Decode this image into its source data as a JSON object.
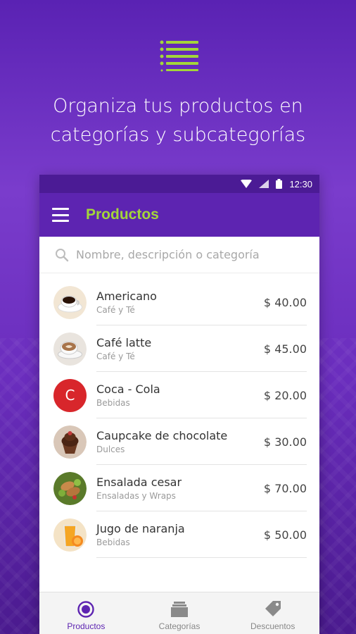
{
  "hero": {
    "icon": "list-icon",
    "title_line1": "Organiza tus productos en",
    "title_line2": "categorías y subcategorías"
  },
  "status_bar": {
    "time": "12:30"
  },
  "app_bar": {
    "title": "Productos"
  },
  "search": {
    "placeholder": "Nombre, descripción o categoría"
  },
  "products": [
    {
      "name": "Americano",
      "category": "Café y Té",
      "price": "$ 40.00",
      "image": "coffee-cup"
    },
    {
      "name": "Café latte",
      "category": "Café y Té",
      "price": "$ 45.00",
      "image": "latte-cup"
    },
    {
      "name": "Coca - Cola",
      "category": "Bebidas",
      "price": "$ 20.00",
      "letter": "C"
    },
    {
      "name": "Caupcake de chocolate",
      "category": "Dulces",
      "price": "$ 30.00",
      "image": "cupcake"
    },
    {
      "name": "Ensalada cesar",
      "category": "Ensaladas y Wraps",
      "price": "$ 70.00",
      "image": "salad"
    },
    {
      "name": "Jugo de naranja",
      "category": "Bebidas",
      "price": "$ 50.00",
      "image": "orange-juice"
    }
  ],
  "bottom_nav": [
    {
      "label": "Productos",
      "icon": "circle-target-icon",
      "active": true
    },
    {
      "label": "Categorías",
      "icon": "stack-icon",
      "active": false
    },
    {
      "label": "Descuentos",
      "icon": "tag-icon",
      "active": false
    }
  ],
  "colors": {
    "accent_green": "#a3d63a",
    "primary_purple": "#5d24b1",
    "status_purple": "#4b1b95",
    "letter_avatar_red": "#d8262b"
  }
}
